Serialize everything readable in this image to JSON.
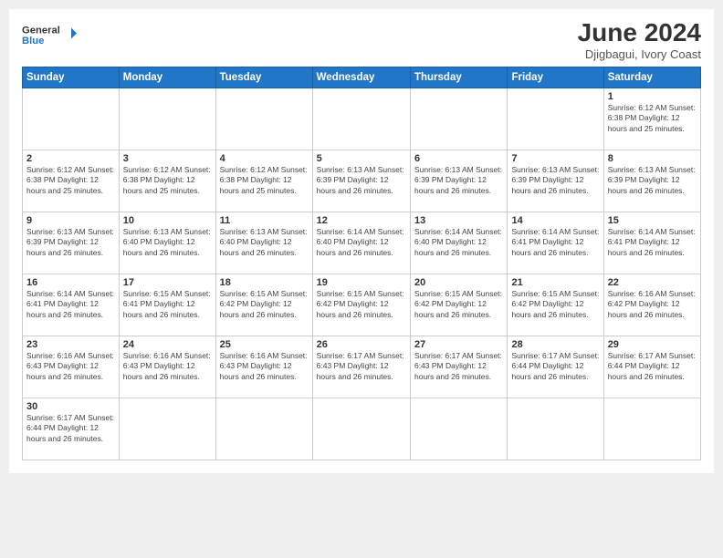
{
  "logo": {
    "text_general": "General",
    "text_blue": "Blue"
  },
  "header": {
    "month_year": "June 2024",
    "location": "Djigbagui, Ivory Coast"
  },
  "weekdays": [
    "Sunday",
    "Monday",
    "Tuesday",
    "Wednesday",
    "Thursday",
    "Friday",
    "Saturday"
  ],
  "weeks": [
    [
      {
        "day": "",
        "info": ""
      },
      {
        "day": "",
        "info": ""
      },
      {
        "day": "",
        "info": ""
      },
      {
        "day": "",
        "info": ""
      },
      {
        "day": "",
        "info": ""
      },
      {
        "day": "",
        "info": ""
      },
      {
        "day": "1",
        "info": "Sunrise: 6:12 AM\nSunset: 6:38 PM\nDaylight: 12 hours\nand 25 minutes."
      }
    ],
    [
      {
        "day": "2",
        "info": "Sunrise: 6:12 AM\nSunset: 6:38 PM\nDaylight: 12 hours\nand 25 minutes."
      },
      {
        "day": "3",
        "info": "Sunrise: 6:12 AM\nSunset: 6:38 PM\nDaylight: 12 hours\nand 25 minutes."
      },
      {
        "day": "4",
        "info": "Sunrise: 6:12 AM\nSunset: 6:38 PM\nDaylight: 12 hours\nand 25 minutes."
      },
      {
        "day": "5",
        "info": "Sunrise: 6:13 AM\nSunset: 6:39 PM\nDaylight: 12 hours\nand 26 minutes."
      },
      {
        "day": "6",
        "info": "Sunrise: 6:13 AM\nSunset: 6:39 PM\nDaylight: 12 hours\nand 26 minutes."
      },
      {
        "day": "7",
        "info": "Sunrise: 6:13 AM\nSunset: 6:39 PM\nDaylight: 12 hours\nand 26 minutes."
      },
      {
        "day": "8",
        "info": "Sunrise: 6:13 AM\nSunset: 6:39 PM\nDaylight: 12 hours\nand 26 minutes."
      }
    ],
    [
      {
        "day": "9",
        "info": "Sunrise: 6:13 AM\nSunset: 6:39 PM\nDaylight: 12 hours\nand 26 minutes."
      },
      {
        "day": "10",
        "info": "Sunrise: 6:13 AM\nSunset: 6:40 PM\nDaylight: 12 hours\nand 26 minutes."
      },
      {
        "day": "11",
        "info": "Sunrise: 6:13 AM\nSunset: 6:40 PM\nDaylight: 12 hours\nand 26 minutes."
      },
      {
        "day": "12",
        "info": "Sunrise: 6:14 AM\nSunset: 6:40 PM\nDaylight: 12 hours\nand 26 minutes."
      },
      {
        "day": "13",
        "info": "Sunrise: 6:14 AM\nSunset: 6:40 PM\nDaylight: 12 hours\nand 26 minutes."
      },
      {
        "day": "14",
        "info": "Sunrise: 6:14 AM\nSunset: 6:41 PM\nDaylight: 12 hours\nand 26 minutes."
      },
      {
        "day": "15",
        "info": "Sunrise: 6:14 AM\nSunset: 6:41 PM\nDaylight: 12 hours\nand 26 minutes."
      }
    ],
    [
      {
        "day": "16",
        "info": "Sunrise: 6:14 AM\nSunset: 6:41 PM\nDaylight: 12 hours\nand 26 minutes."
      },
      {
        "day": "17",
        "info": "Sunrise: 6:15 AM\nSunset: 6:41 PM\nDaylight: 12 hours\nand 26 minutes."
      },
      {
        "day": "18",
        "info": "Sunrise: 6:15 AM\nSunset: 6:42 PM\nDaylight: 12 hours\nand 26 minutes."
      },
      {
        "day": "19",
        "info": "Sunrise: 6:15 AM\nSunset: 6:42 PM\nDaylight: 12 hours\nand 26 minutes."
      },
      {
        "day": "20",
        "info": "Sunrise: 6:15 AM\nSunset: 6:42 PM\nDaylight: 12 hours\nand 26 minutes."
      },
      {
        "day": "21",
        "info": "Sunrise: 6:15 AM\nSunset: 6:42 PM\nDaylight: 12 hours\nand 26 minutes."
      },
      {
        "day": "22",
        "info": "Sunrise: 6:16 AM\nSunset: 6:42 PM\nDaylight: 12 hours\nand 26 minutes."
      }
    ],
    [
      {
        "day": "23",
        "info": "Sunrise: 6:16 AM\nSunset: 6:43 PM\nDaylight: 12 hours\nand 26 minutes."
      },
      {
        "day": "24",
        "info": "Sunrise: 6:16 AM\nSunset: 6:43 PM\nDaylight: 12 hours\nand 26 minutes."
      },
      {
        "day": "25",
        "info": "Sunrise: 6:16 AM\nSunset: 6:43 PM\nDaylight: 12 hours\nand 26 minutes."
      },
      {
        "day": "26",
        "info": "Sunrise: 6:17 AM\nSunset: 6:43 PM\nDaylight: 12 hours\nand 26 minutes."
      },
      {
        "day": "27",
        "info": "Sunrise: 6:17 AM\nSunset: 6:43 PM\nDaylight: 12 hours\nand 26 minutes."
      },
      {
        "day": "28",
        "info": "Sunrise: 6:17 AM\nSunset: 6:44 PM\nDaylight: 12 hours\nand 26 minutes."
      },
      {
        "day": "29",
        "info": "Sunrise: 6:17 AM\nSunset: 6:44 PM\nDaylight: 12 hours\nand 26 minutes."
      }
    ],
    [
      {
        "day": "30",
        "info": "Sunrise: 6:17 AM\nSunset: 6:44 PM\nDaylight: 12 hours\nand 26 minutes."
      },
      {
        "day": "",
        "info": ""
      },
      {
        "day": "",
        "info": ""
      },
      {
        "day": "",
        "info": ""
      },
      {
        "day": "",
        "info": ""
      },
      {
        "day": "",
        "info": ""
      },
      {
        "day": "",
        "info": ""
      }
    ]
  ]
}
